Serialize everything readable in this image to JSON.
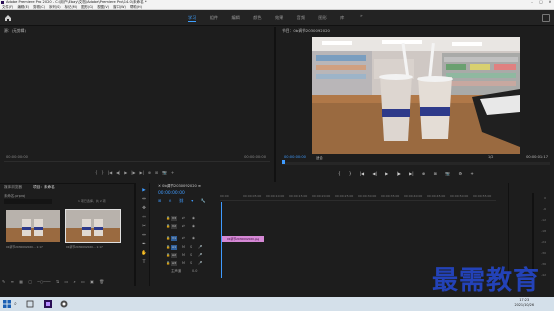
{
  "window": {
    "title": "Adobe Premiere Pro 2020 - C:\\用户\\Ebay\\文档\\Adobe\\Premiere Pro\\14.0\\未命名 *",
    "controls": [
      "–",
      "□",
      "✕"
    ]
  },
  "menu": [
    "文件(F)",
    "编辑(E)",
    "剪辑(C)",
    "序列(S)",
    "标记(M)",
    "图形(G)",
    "视图(V)",
    "窗口(W)",
    "帮助(H)"
  ],
  "workspaces": {
    "tabs": [
      {
        "label": "学习",
        "active": true
      },
      {
        "label": "组件",
        "active": false
      },
      {
        "label": "编辑",
        "active": false
      },
      {
        "label": "颜色",
        "active": false
      },
      {
        "label": "效果",
        "active": false
      },
      {
        "label": "音频",
        "active": false
      },
      {
        "label": "图形",
        "active": false
      },
      {
        "label": "库",
        "active": false
      }
    ],
    "more": "»"
  },
  "source_monitor": {
    "title": "源：(无剪辑)",
    "timecode_in": "00:00:00:00",
    "timecode_out": "00:00:00:00",
    "buttons": [
      "{",
      "}",
      "|◀",
      "◀|",
      "▶",
      "|▶",
      "▶|",
      "⊕",
      "⊞",
      "📷",
      "+"
    ]
  },
  "program_monitor": {
    "title": "节目：0b调节2030092020",
    "timecode": "00:00:00:00",
    "fit": "适合",
    "ratio": "1/2",
    "duration": "00:00:01:17",
    "buttons": [
      "{",
      "}",
      "|◀",
      "◀|",
      "▶",
      "|▶",
      "▶|",
      "⊕",
      "⊞",
      "📷",
      "⚙",
      "+"
    ]
  },
  "project": {
    "tabs": [
      {
        "label": "媒体浏览器",
        "active": false
      },
      {
        "label": "项目：未命名",
        "active": true
      }
    ],
    "name": "未命名.prproj",
    "search_placeholder": "",
    "count": "1 项已选择，共 2 项",
    "items": [
      {
        "label": "0b调节2030092020...",
        "duration": "1:17",
        "selected": false
      },
      {
        "label": "0b调节2030092020...",
        "duration": "1:17",
        "selected": true
      }
    ]
  },
  "tools": [
    "▶",
    "⇔",
    "✥",
    "⇿",
    "✂",
    "↔",
    "✒",
    "✋",
    "T"
  ],
  "timeline": {
    "tab": "0b调节2030092020",
    "timecode": "00:00:00:00",
    "ruler": [
      "00:00",
      "00:00:05:00",
      "00:00:10:00",
      "00:00:15:00",
      "00:00:20:00",
      "00:00:25:00",
      "00:00:30:00",
      "00:00:35:00",
      "00:00:40:00",
      "00:00:45:00",
      "00:00:50:00",
      "00:00:55:00"
    ],
    "tracks": [
      {
        "name": "V3",
        "on": false
      },
      {
        "name": "V2",
        "on": false
      },
      {
        "name": "V1",
        "on": true
      },
      {
        "name": "A1",
        "on": true
      },
      {
        "name": "A2",
        "on": false
      },
      {
        "name": "A3",
        "on": false
      }
    ],
    "master": "主声道",
    "master_value": "0.0",
    "clip_label": "0b调节2030092020.jpg"
  },
  "meter": {
    "ticks": [
      "0",
      "-6",
      "-12",
      "-18",
      "-24",
      "-30",
      "-36",
      "-42",
      "-48",
      "dB"
    ]
  },
  "taskbar": {
    "time": "17:23",
    "date": "2021/10/26"
  },
  "watermark": "最需教育",
  "colors": {
    "accent": "#3f9bff",
    "clip": "#d588d5",
    "watermark": "#2342b8"
  }
}
